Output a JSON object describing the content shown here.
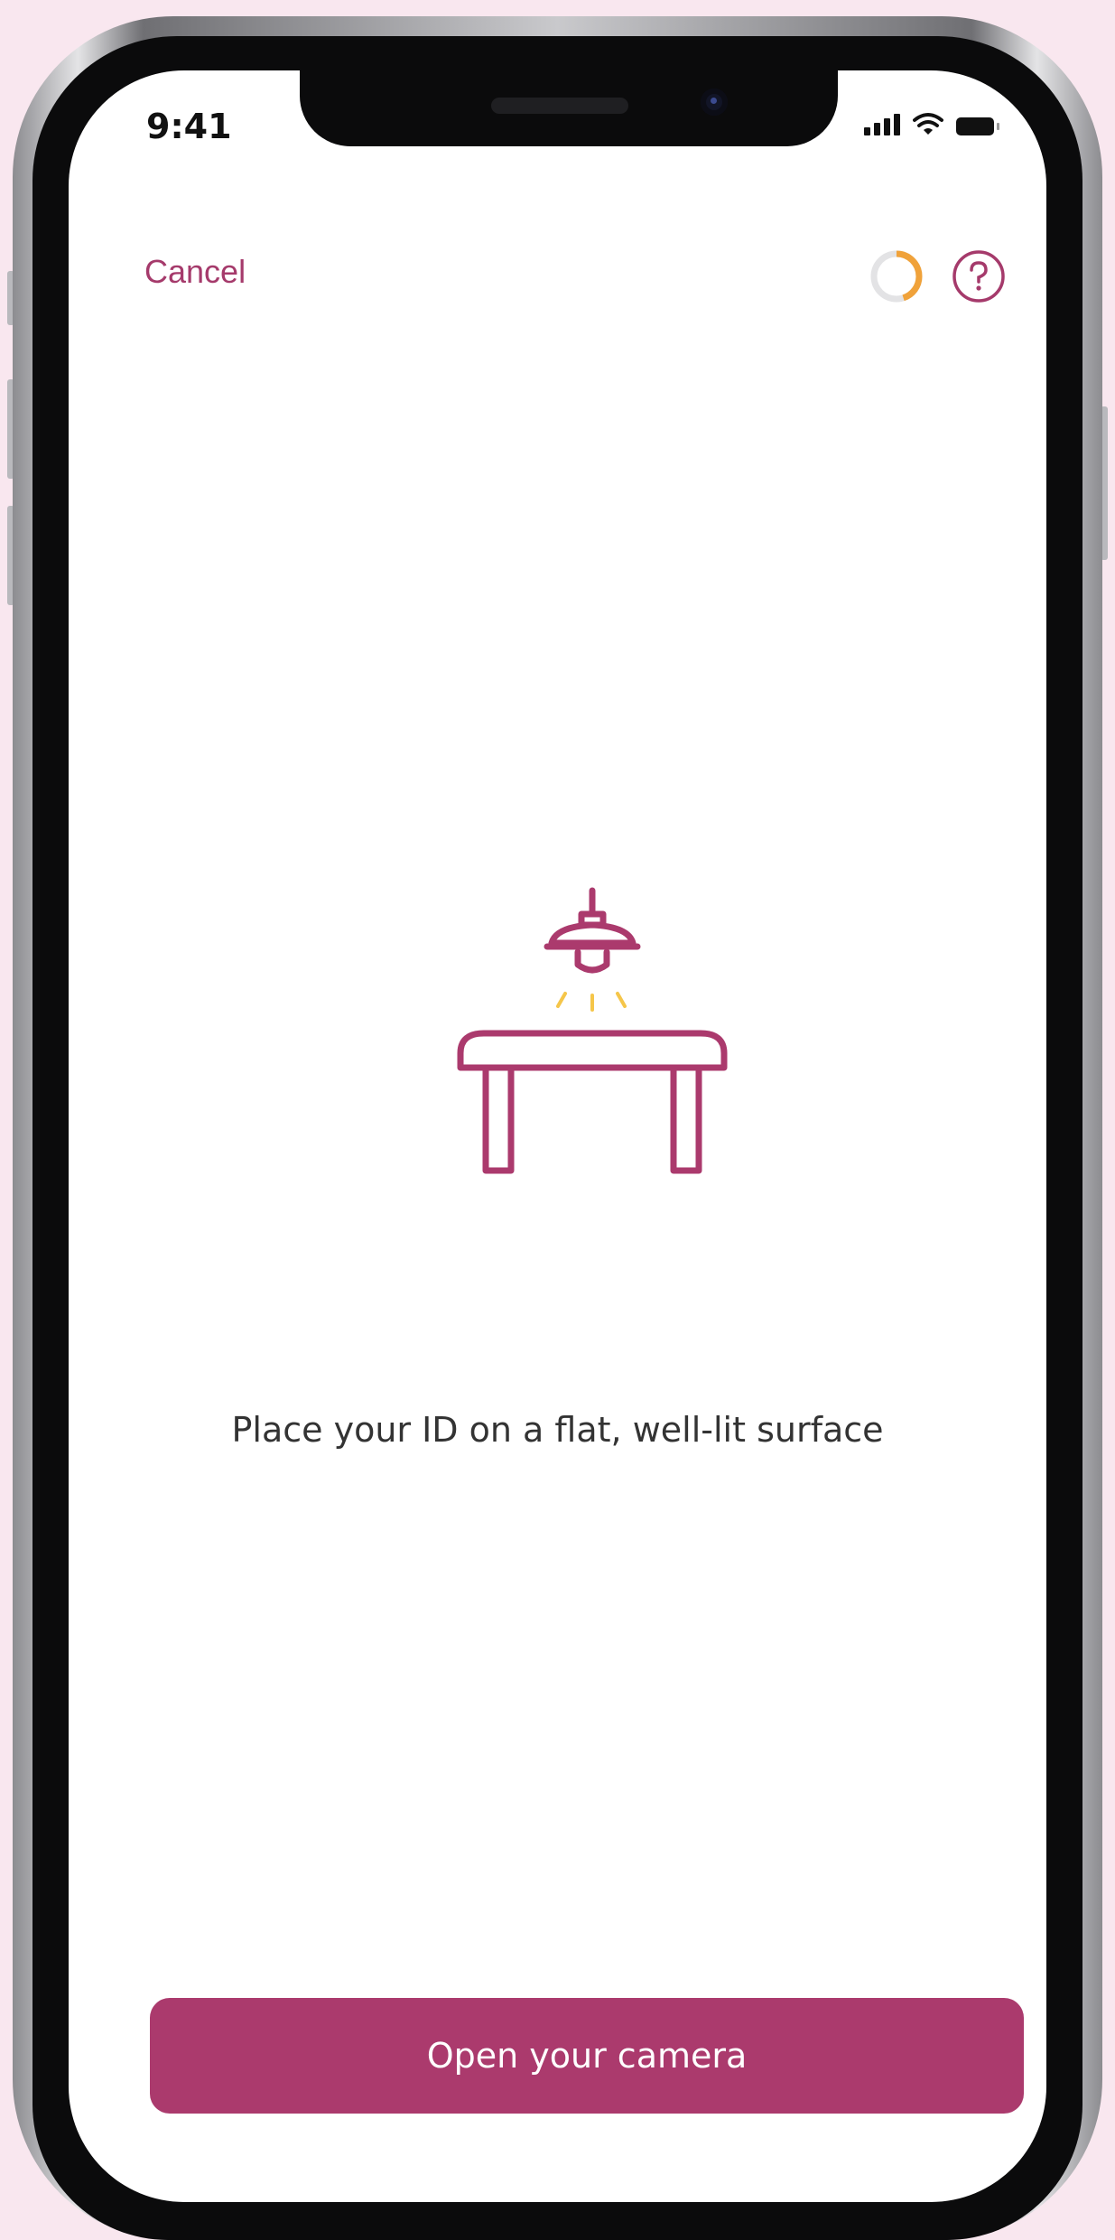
{
  "status_bar": {
    "time": "9:41"
  },
  "header": {
    "cancel_label": "Cancel",
    "progress_icon": "progress-ring-icon",
    "progress_fraction": 0.45,
    "help_icon": "question-circle-icon"
  },
  "main": {
    "illustration_icon": "lamp-over-table-icon",
    "instruction": "Place your ID on a flat, well-lit surface"
  },
  "footer": {
    "camera_button_label": "Open your camera"
  },
  "colors": {
    "accent": "#ab3a6d",
    "progress": "#f0a23a",
    "light_rays": "#f5c64a",
    "background": "#f9e7ef"
  }
}
